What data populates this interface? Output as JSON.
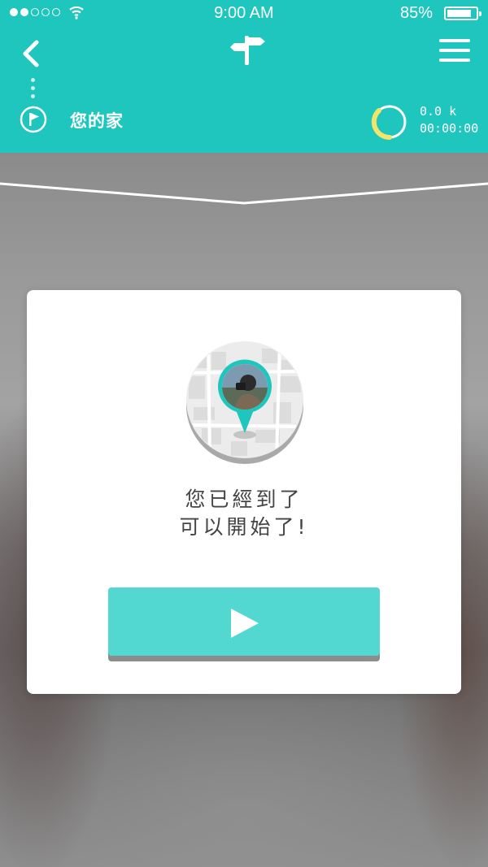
{
  "status_bar": {
    "signal_dots_filled": 2,
    "signal_dots_total": 5,
    "time": "9:00  AM",
    "battery_percent": "85%",
    "battery_level": 0.85
  },
  "header": {
    "back_icon": "chevron-left-icon",
    "logo_icon": "signpost-icon",
    "menu_icon": "hamburger-menu-icon",
    "destination_icon": "flag-icon",
    "destination": "您的家",
    "distance": "0.0 k",
    "duration": "00:00:00",
    "progress_icon": "progress-ring-icon"
  },
  "card": {
    "message_line1": "您已經到了",
    "message_line2": "可以開始了!",
    "play_icon": "play-icon"
  },
  "colors": {
    "brand": "#1fc6be",
    "button": "#52d8d0",
    "progress_ring": "#f2e56b"
  }
}
